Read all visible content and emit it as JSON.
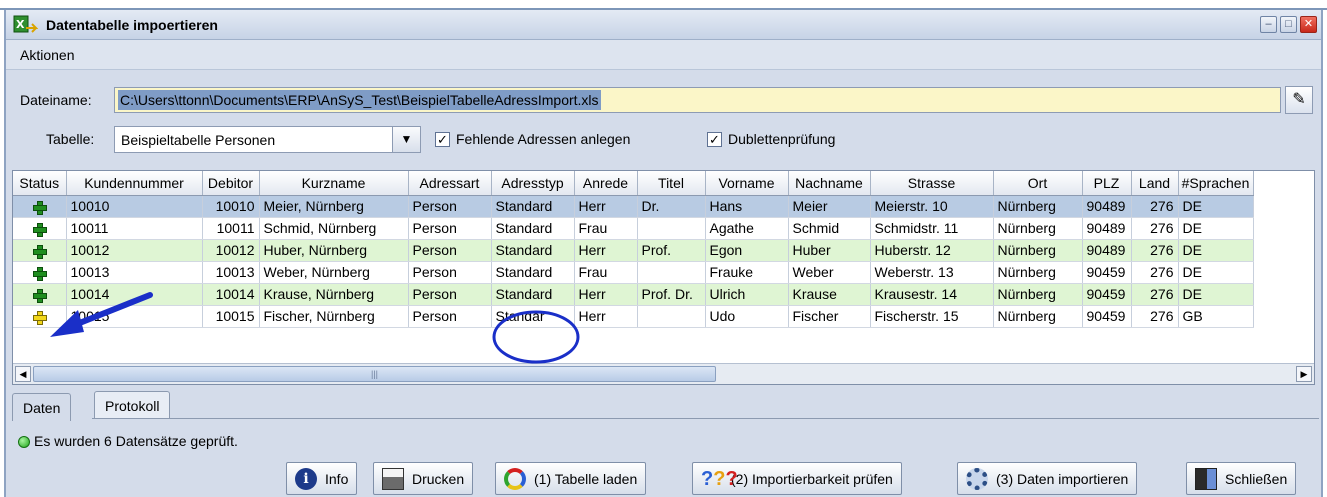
{
  "window": {
    "title": "Datentabelle impoertieren",
    "controls": {
      "minimize": "–",
      "maximize": "□",
      "close": "✕"
    }
  },
  "menu": {
    "items": [
      "Aktionen"
    ]
  },
  "form": {
    "filename_label": "Dateiname:",
    "filename_value": "C:\\Users\\ttonn\\Documents\\ERP\\AnSyS_Test\\BeispielTabelleAdressImport.xls",
    "table_label": "Tabelle:",
    "table_value": "Beispieltabelle Personen",
    "checkbox_missing_label": "Fehlende Adressen anlegen",
    "checkbox_missing_checked": true,
    "checkbox_duplicates_label": "Dublettenprüfung",
    "checkbox_duplicates_checked": true
  },
  "table": {
    "columns": [
      "Status",
      "Kundennummer",
      "Debitor",
      "Kurzname",
      "Adressart",
      "Adresstyp",
      "Anrede",
      "Titel",
      "Vorname",
      "Nachname",
      "Strasse",
      "Ort",
      "PLZ",
      "Land",
      "#Sprachen"
    ],
    "rows": [
      {
        "status": "green",
        "style": "sel",
        "cells": [
          "10010",
          "10010",
          "Meier, Nürnberg",
          "Person",
          "Standard",
          "Herr",
          "Dr.",
          "Hans",
          "Meier",
          "Meierstr. 10",
          "Nürnberg",
          "90489",
          "276",
          "DE"
        ]
      },
      {
        "status": "green",
        "style": "white",
        "cells": [
          "10011",
          "10011",
          "Schmid, Nürnberg",
          "Person",
          "Standard",
          "Frau",
          "",
          "Agathe",
          "Schmid",
          "Schmidstr. 11",
          "Nürnberg",
          "90489",
          "276",
          "DE"
        ]
      },
      {
        "status": "green",
        "style": "green",
        "cells": [
          "10012",
          "10012",
          "Huber, Nürnberg",
          "Person",
          "Standard",
          "Herr",
          "Prof.",
          "Egon",
          "Huber",
          "Huberstr. 12",
          "Nürnberg",
          "90489",
          "276",
          "DE"
        ]
      },
      {
        "status": "green",
        "style": "white",
        "cells": [
          "10013",
          "10013",
          "Weber, Nürnberg",
          "Person",
          "Standard",
          "Frau",
          "",
          "Frauke",
          "Weber",
          "Weberstr. 13",
          "Nürnberg",
          "90459",
          "276",
          "DE"
        ]
      },
      {
        "status": "green",
        "style": "green",
        "cells": [
          "10014",
          "10014",
          "Krause, Nürnberg",
          "Person",
          "Standard",
          "Herr",
          "Prof. Dr.",
          "Ulrich",
          "Krause",
          "Krausestr. 14",
          "Nürnberg",
          "90459",
          "276",
          "DE"
        ]
      },
      {
        "status": "yellow",
        "style": "white",
        "cells": [
          "10015",
          "10015",
          "Fischer, Nürnberg",
          "Person",
          "Standar",
          "Herr",
          "",
          "Udo",
          "Fischer",
          "Fischerstr. 15",
          "Nürnberg",
          "90459",
          "276",
          "GB"
        ]
      }
    ]
  },
  "tabs": {
    "active": "Daten",
    "inactive": "Protokoll"
  },
  "status_message": "Es wurden 6 Datensätze geprüft.",
  "buttons": {
    "info": "Info",
    "print": "Drucken",
    "load": "(1) Tabelle laden",
    "check": "(2) Importierbarkeit prüfen",
    "import": "(3) Daten importieren",
    "close": "Schließen"
  },
  "icons": {
    "status_ok": "green-plus-icon",
    "status_warning": "yellow-plus-icon",
    "info": "info-icon",
    "print": "printer-icon",
    "load": "refresh-icon",
    "check": "question-marks-icon",
    "import": "gear-icon",
    "close": "exit-door-icon"
  },
  "colors": {
    "selection": "#b8cbe3",
    "green_row": "#dff5d3",
    "file_field": "#fbf6c8",
    "annotation": "#1a2fc8"
  }
}
